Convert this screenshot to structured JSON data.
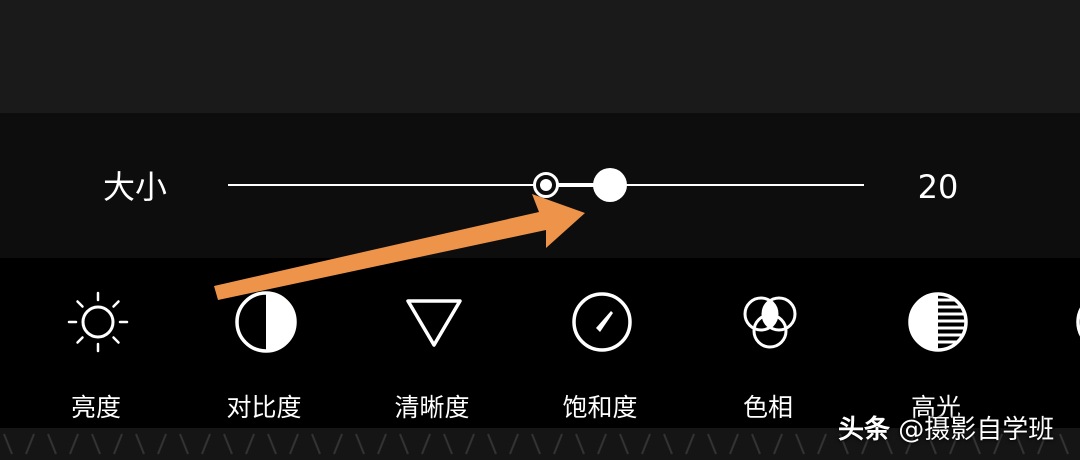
{
  "slider": {
    "label": "大小",
    "value": "20",
    "origin_fraction": 0.5,
    "thumb_fraction": 0.6
  },
  "tools": [
    {
      "label": "亮度",
      "icon": "sun-icon",
      "selected": true
    },
    {
      "label": "对比度",
      "icon": "contrast-icon",
      "selected": false
    },
    {
      "label": "清晰度",
      "icon": "triangle-down-icon",
      "selected": false
    },
    {
      "label": "饱和度",
      "icon": "gauge-icon",
      "selected": false
    },
    {
      "label": "色相",
      "icon": "color-circles-icon",
      "selected": false
    },
    {
      "label": "高光",
      "icon": "highlights-icon",
      "selected": false
    }
  ],
  "watermark": {
    "brand": "头条",
    "handle": "@摄影自学班"
  },
  "colors": {
    "selected_bg": "#0c5384",
    "selected_border": "#2a97e6",
    "arrow": "#ee934a"
  }
}
